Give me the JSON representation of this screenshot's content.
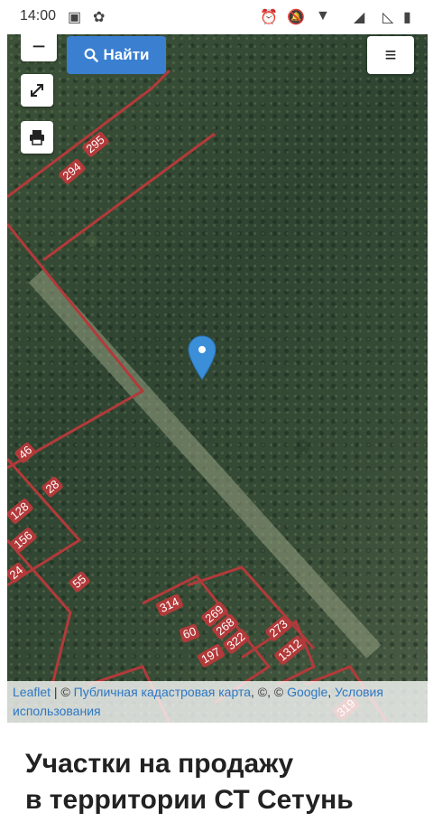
{
  "status_bar": {
    "time": "14:00",
    "left_icons": [
      "image-icon",
      "app-icon"
    ],
    "right_icons": [
      "alarm-icon",
      "mute-icon",
      "wifi-icon",
      "signal-icon",
      "signal-empty-icon",
      "battery-icon"
    ]
  },
  "map": {
    "search_button_label": "Найти",
    "zoom_out_label": "−",
    "menu_label": "≡",
    "parcels": [
      "295",
      "294",
      "46",
      "28",
      "128",
      "156",
      "55",
      "314",
      "269",
      "60",
      "268",
      "322",
      "197",
      "273",
      "1312",
      "319",
      "24"
    ],
    "attribution": {
      "leaflet": "Leaflet",
      "separator": " | © ",
      "cadastral": "Публичная кадастровая карта",
      "middle": ", ©, © ",
      "google": "Google",
      "comma": ", ",
      "terms": "Условия использования"
    }
  },
  "page": {
    "heading_line1": "Участки на продажу",
    "heading_line2": "в территории СТ Сетунь"
  },
  "colors": {
    "search_button": "#3a7fd0",
    "parcel_border": "#b33a3a",
    "marker": "#3b8fd8",
    "link": "#2d78c4"
  }
}
